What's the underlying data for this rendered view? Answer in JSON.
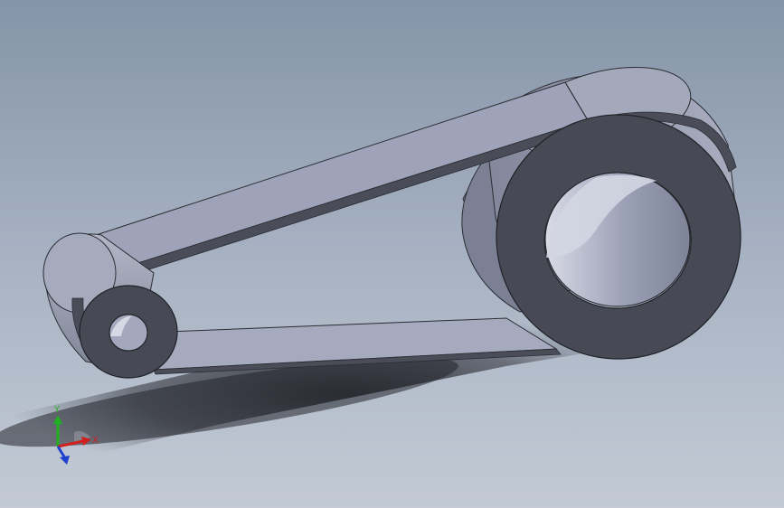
{
  "viewport": {
    "background_top": "#8594a8",
    "background_bottom": "#c3cad5"
  },
  "model": {
    "belt_color": "#9a9eb5",
    "belt_edge_color": "#4a4d58",
    "pulley_face_color": "#474a54",
    "pulley_side_color": "#8e93a6",
    "bore_color": "#9ea3b8"
  },
  "triad": {
    "x_label": "X",
    "y_label": "Y",
    "x_color": "#d02020",
    "y_color": "#20b020",
    "z_color": "#2040d0"
  }
}
